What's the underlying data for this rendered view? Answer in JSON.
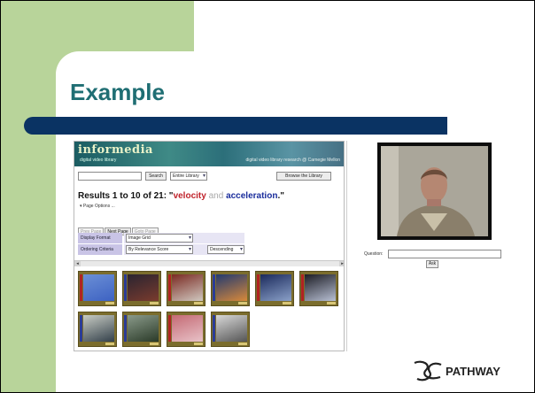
{
  "slide": {
    "title": "Example"
  },
  "browser": {
    "logo": "informedia",
    "logo_sub": "digital video library",
    "banner_tag": "digital video library research @ Carnegie Mellon",
    "search": {
      "value": "",
      "button": "Search",
      "scope": "Entire Library",
      "browse": "Browse the Library"
    },
    "results": {
      "prefix": "Results 1 to 10 of 21: \"",
      "term1": "velocity",
      "mid": " and ",
      "term2": "acceleration",
      "suffix": ".\""
    },
    "page_options": "▾ Page Options ...",
    "pagers": [
      "Prev Page",
      "Next Page",
      "Goto Page"
    ],
    "options": [
      {
        "label": "Display Format",
        "value": "Image Grid"
      },
      {
        "label": "Ordering Criteria",
        "value": "By Relevance Score",
        "order": "Descending"
      }
    ],
    "thumbnails": [
      {
        "strip": "red",
        "colors": [
          "#6b8fd6",
          "#3d62c2"
        ]
      },
      {
        "strip": "blue",
        "colors": [
          "#2a2430",
          "#7a3b2e"
        ]
      },
      {
        "strip": "red",
        "colors": [
          "#7a2a22",
          "#d0c8c0"
        ]
      },
      {
        "strip": "blue",
        "colors": [
          "#223a70",
          "#d8893a"
        ]
      },
      {
        "strip": "red",
        "colors": [
          "#1b2a5c",
          "#8aa0c8"
        ]
      },
      {
        "strip": "red",
        "colors": [
          "#1c1c24",
          "#b8c0d4"
        ]
      },
      {
        "strip": "blue",
        "colors": [
          "#c8ccc4",
          "#33404a"
        ]
      },
      {
        "strip": "blue",
        "colors": [
          "#8a9a8a",
          "#2a3a28"
        ]
      },
      {
        "strip": "red",
        "colors": [
          "#c46a74",
          "#e8c2c8"
        ]
      },
      {
        "strip": "blue",
        "colors": [
          "#d8d8d8",
          "#555555"
        ]
      }
    ]
  },
  "qa": {
    "question_label": "Question:",
    "ask": "Ask"
  },
  "logo": {
    "text": "PATHWAY"
  },
  "colors": {
    "green": "#b8d49a",
    "bar": "#0a3363",
    "title": "#1f6e73"
  }
}
